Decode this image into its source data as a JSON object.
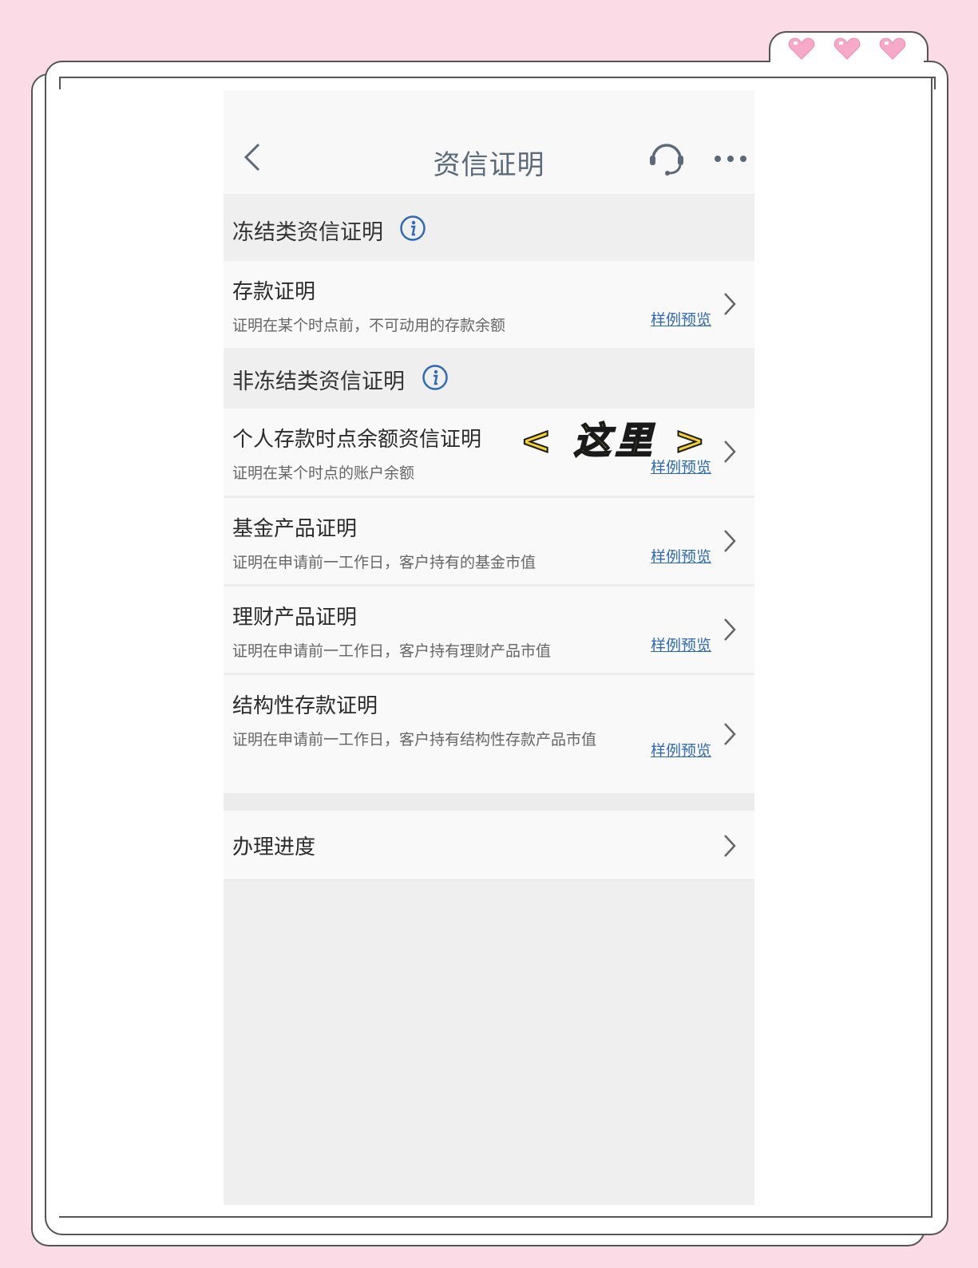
{
  "nav": {
    "title": "资信证明"
  },
  "sections": {
    "frozen": {
      "title": "冻结类资信证明"
    },
    "nonfrozen": {
      "title": "非冻结类资信证明"
    }
  },
  "items": [
    {
      "title": "存款证明",
      "desc": "证明在某个时点前，不可动用的存款余额",
      "link": "样例预览"
    },
    {
      "title": "个人存款时点余额资信证明",
      "desc": "证明在某个时点的账户余额",
      "link": "样例预览"
    },
    {
      "title": "基金产品证明",
      "desc": "证明在申请前一工作日，客户持有的基金市值",
      "link": "样例预览"
    },
    {
      "title": "理财产品证明",
      "desc": "证明在申请前一工作日，客户持有理财产品市值",
      "link": "样例预览"
    },
    {
      "title": "结构性存款证明",
      "desc": "证明在申请前一工作日，客户持有结构性存款产品市值",
      "link": "样例预览"
    }
  ],
  "progress": {
    "title": "办理进度"
  },
  "annotation": {
    "text": "< 这里 >"
  },
  "colors": {
    "accent": "#2f6ab5",
    "annotation": "#f5cf2a",
    "background": "#fadbe6"
  },
  "icons": [
    "back-arrow-icon",
    "headset-icon",
    "more-icon",
    "info-icon",
    "chevron-right-icon",
    "heart-icon"
  ]
}
